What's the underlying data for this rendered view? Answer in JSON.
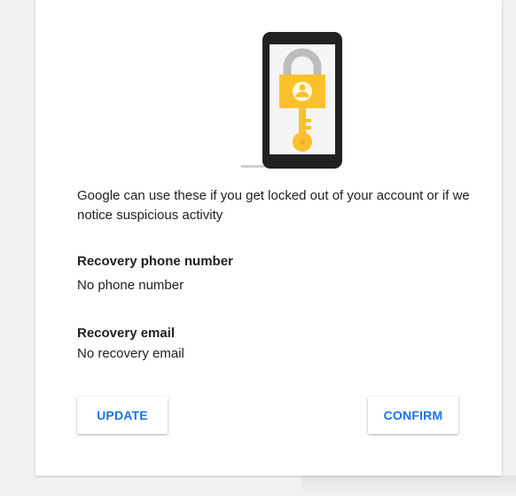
{
  "hero": {
    "icon": "phone-lock-key-illustration",
    "colors": {
      "phone": "#212121",
      "screen": "#f5f5f5",
      "lock": "#fbc02d",
      "shackle": "#bdbdbd"
    }
  },
  "description": "Google can use these if you get locked out of your account or if we notice suspicious activity",
  "recovery_phone": {
    "title": "Recovery phone number",
    "value": "No phone number"
  },
  "recovery_email": {
    "title": "Recovery email",
    "value": "No recovery email"
  },
  "actions": {
    "update_label": "UPDATE",
    "confirm_label": "CONFIRM"
  },
  "theme": {
    "accent": "#1a73e8",
    "text": "#212121",
    "card": "#ffffff",
    "background": "#f1f1f1"
  }
}
